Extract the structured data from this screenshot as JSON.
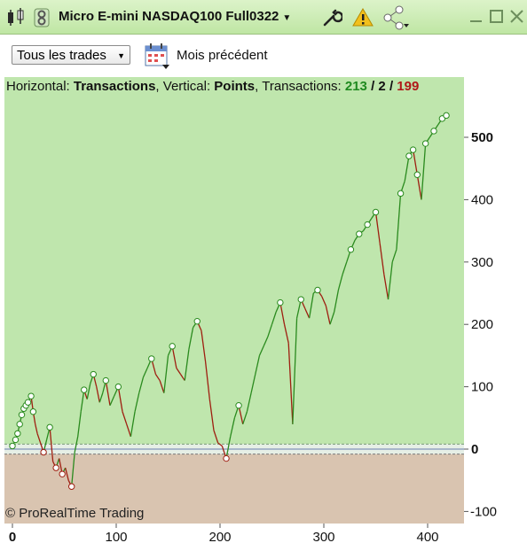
{
  "window": {
    "title": "Micro E-mini NASDAQ100 Full0322",
    "icons": [
      "candlestick-icon",
      "link-icon",
      "wrench-icon",
      "warning-icon",
      "share-icon",
      "minimize-icon",
      "maximize-icon",
      "close-icon"
    ]
  },
  "toolbar": {
    "trades_select": "Tous les trades",
    "period_label": "Mois précédent"
  },
  "header": {
    "horizontal_label": "Horizontal:",
    "horizontal_value": "Transactions",
    "vertical_label": "Vertical:",
    "vertical_value": "Points",
    "transactions_label": "Transactions:",
    "wins": "213",
    "sep1": "/",
    "neutral": "2",
    "sep2": "/",
    "losses": "199"
  },
  "copyright": "© ProRealTime Trading",
  "colors": {
    "positive_bg": "#bfe6ad",
    "negative_bg": "#d9c4b0",
    "up_line": "#2a8a1e",
    "down_line": "#9e1e10"
  },
  "chart_data": {
    "type": "line",
    "title": "",
    "xlabel": "Transactions",
    "ylabel": "Points",
    "x_ticks": [
      "0",
      "100",
      "200",
      "300",
      "400"
    ],
    "y_ticks": [
      "500",
      "400",
      "300",
      "200",
      "100",
      "0",
      "-100"
    ],
    "xlim": [
      0,
      435
    ],
    "ylim": [
      -115,
      560
    ],
    "grid": true,
    "series": [
      {
        "name": "",
        "x": [
          0,
          3,
          5,
          7,
          9,
          11,
          13,
          15,
          18,
          20,
          22,
          24,
          27,
          30,
          33,
          36,
          39,
          42,
          45,
          48,
          51,
          54,
          57,
          60,
          63,
          66,
          69,
          72,
          75,
          78,
          81,
          84,
          87,
          90,
          94,
          98,
          102,
          106,
          110,
          114,
          118,
          122,
          126,
          130,
          134,
          138,
          142,
          146,
          150,
          154,
          158,
          162,
          166,
          170,
          174,
          178,
          182,
          186,
          190,
          194,
          198,
          202,
          206,
          210,
          214,
          218,
          222,
          226,
          230,
          234,
          238,
          242,
          246,
          250,
          254,
          258,
          262,
          266,
          270,
          274,
          278,
          282,
          286,
          290,
          294,
          298,
          302,
          306,
          310,
          314,
          318,
          322,
          326,
          330,
          334,
          338,
          342,
          346,
          350,
          354,
          358,
          362,
          366,
          370,
          374,
          378,
          382,
          386,
          390,
          394,
          398,
          402,
          406,
          410,
          414,
          418
        ],
        "y": [
          5,
          15,
          25,
          40,
          55,
          65,
          70,
          75,
          85,
          60,
          40,
          25,
          10,
          -5,
          15,
          35,
          -20,
          -30,
          -15,
          -40,
          -30,
          -50,
          -60,
          -5,
          20,
          60,
          95,
          80,
          105,
          120,
          100,
          75,
          90,
          110,
          70,
          85,
          100,
          60,
          40,
          20,
          60,
          90,
          115,
          130,
          145,
          120,
          110,
          90,
          150,
          165,
          130,
          120,
          110,
          160,
          195,
          205,
          190,
          140,
          80,
          30,
          10,
          5,
          -15,
          20,
          50,
          70,
          40,
          60,
          90,
          120,
          150,
          165,
          180,
          200,
          220,
          235,
          200,
          170,
          40,
          210,
          240,
          225,
          210,
          250,
          255,
          245,
          230,
          200,
          220,
          255,
          280,
          300,
          320,
          335,
          345,
          350,
          360,
          370,
          380,
          330,
          280,
          240,
          300,
          320,
          410,
          430,
          470,
          480,
          440,
          400,
          490,
          500,
          510,
          520,
          530,
          535
        ],
        "marker_count_note_ignored": ""
      }
    ]
  }
}
